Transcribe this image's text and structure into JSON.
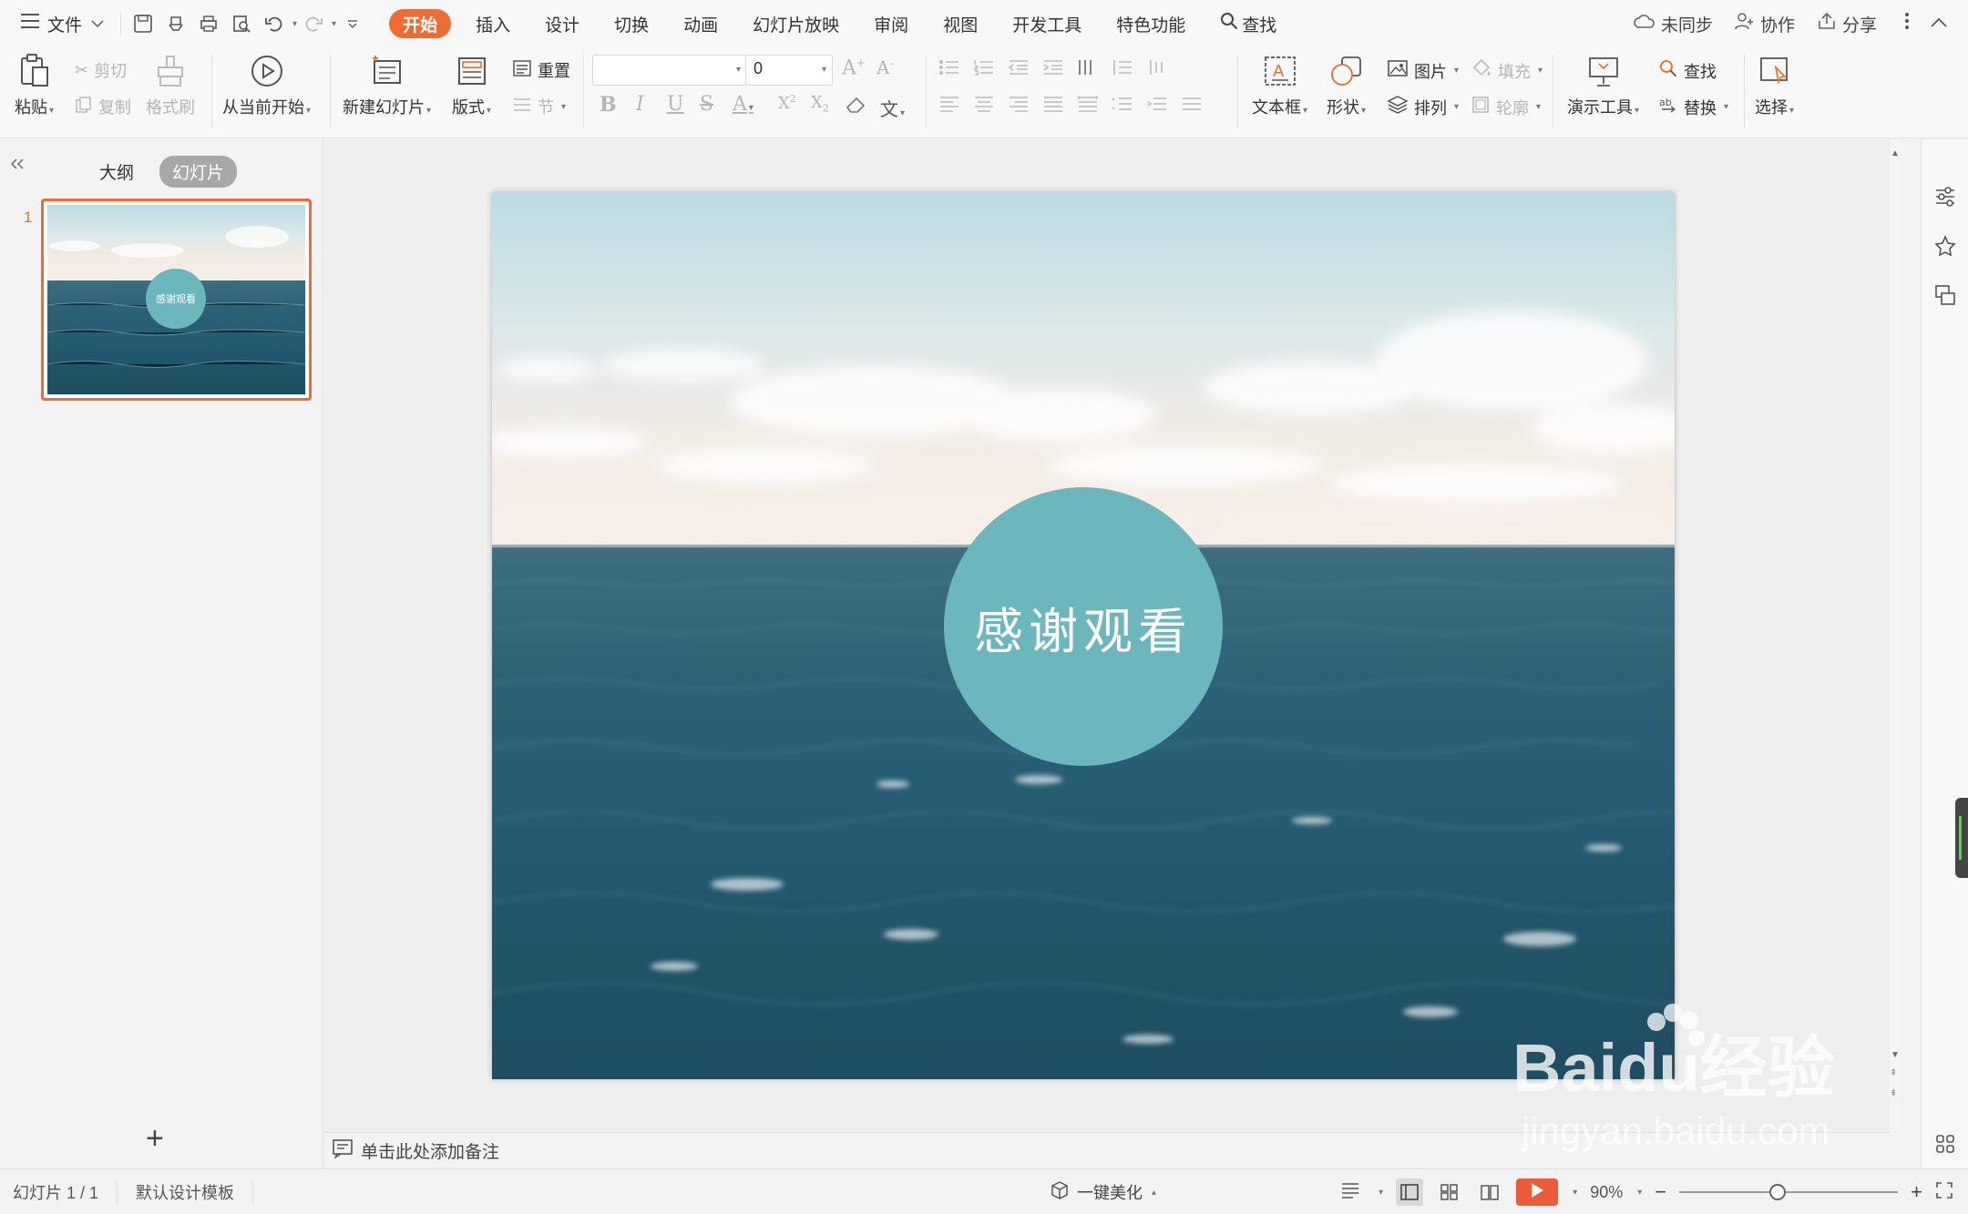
{
  "menubar": {
    "file_label": "文件",
    "tabs": [
      {
        "label": "开始",
        "active": true
      },
      {
        "label": "插入"
      },
      {
        "label": "设计"
      },
      {
        "label": "切换"
      },
      {
        "label": "动画"
      },
      {
        "label": "幻灯片放映"
      },
      {
        "label": "审阅"
      },
      {
        "label": "视图"
      },
      {
        "label": "开发工具"
      },
      {
        "label": "特色功能"
      }
    ],
    "search_label": "查找",
    "sync_label": "未同步",
    "collab_label": "协作",
    "share_label": "分享"
  },
  "ribbon": {
    "paste": "粘贴",
    "cut": "剪切",
    "copy": "复制",
    "format_painter": "格式刷",
    "play_from_current": "从当前开始",
    "new_slide": "新建幻灯片",
    "layout": "版式",
    "reset": "重置",
    "section": "节",
    "font_name_value": "",
    "font_size_value": "0",
    "text_box": "文本框",
    "shape": "形状",
    "picture": "图片",
    "fill": "填充",
    "arrange": "排列",
    "outline": "轮廓",
    "presentation_tools": "演示工具",
    "find": "查找",
    "replace": "替换",
    "select": "选择"
  },
  "left_panel": {
    "tab_outline": "大纲",
    "tab_slides": "幻灯片",
    "active_tab": "幻灯片",
    "slide_number": "1",
    "add_slide_symbol": "+"
  },
  "slide": {
    "title_text": "感谢观看",
    "circle_color": "#6bb7bd"
  },
  "notes": {
    "placeholder": "单击此处添加备注"
  },
  "statusbar": {
    "slide_count": "幻灯片 1 / 1",
    "template": "默认设计模板",
    "beautify": "一键美化",
    "zoom": "90%",
    "zoom_fraction": 0.45
  },
  "watermark": {
    "brand": "Baidu经验",
    "url": "jingyan.baidu.com"
  },
  "colors": {
    "accent": "#ee6c33",
    "play": "#ee5a3a"
  }
}
